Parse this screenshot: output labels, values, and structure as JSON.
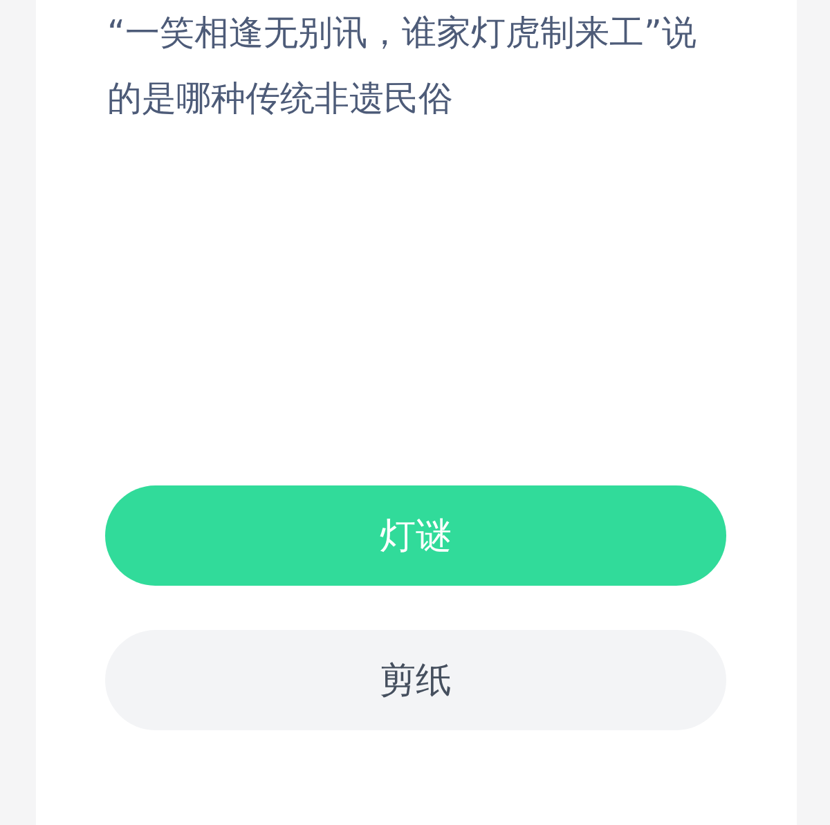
{
  "question": "“一笑相逢无别讯，谁家灯虎制来工”说的是哪种传统非遗民俗",
  "options": [
    {
      "label": "灯谜",
      "selected": true
    },
    {
      "label": "剪纸",
      "selected": false
    }
  ]
}
